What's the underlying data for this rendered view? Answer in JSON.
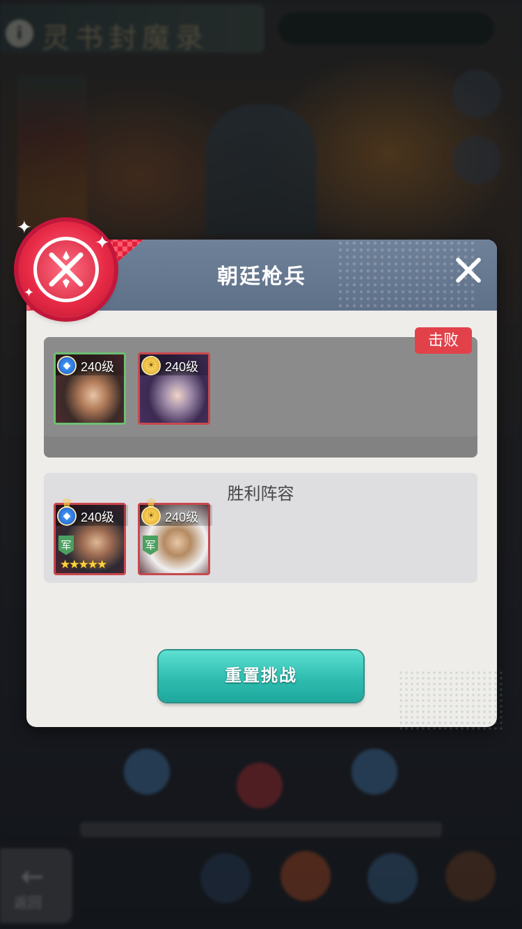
{
  "background": {
    "banner_title": "灵书封魔录",
    "back_label": "返回"
  },
  "dialog": {
    "title": "朝廷枪兵",
    "defeat_badge": "击败",
    "enemy_heroes": [
      {
        "level": "240级",
        "faction": "water-icon"
      },
      {
        "level": "240级",
        "faction": "sun-icon"
      }
    ],
    "victory": {
      "title": "胜利阵容",
      "heroes": [
        {
          "level": "240级",
          "faction": "water-icon",
          "tag": "军",
          "stars": 5
        },
        {
          "level": "240级",
          "faction": "sun-icon",
          "tag": "军",
          "stars": 0
        }
      ]
    },
    "reset_button": "重置挑战"
  },
  "colors": {
    "header": "#6f8199",
    "dialog_bg": "#efedea",
    "defeat_badge": "#e2414a",
    "button": "#2fbdb0",
    "emblem": "#e72a46"
  }
}
